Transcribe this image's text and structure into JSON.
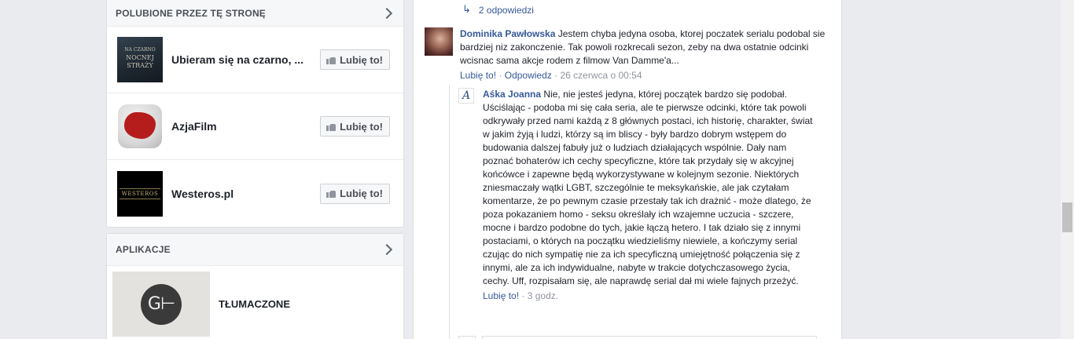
{
  "liked_pages": {
    "header": "POLUBIONE PRZEZ TĘ STRONĘ",
    "items": [
      {
        "name": "Ubieram się na czarno, ...",
        "like_label": "Lubię to!",
        "thumb_lines": [
          "NA CZARNO",
          "NOCNEJ",
          "STRAŻY"
        ]
      },
      {
        "name": "AzjaFilm",
        "like_label": "Lubię to!"
      },
      {
        "name": "Westeros.pl",
        "like_label": "Lubię to!",
        "thumb_text": "WESTEROS"
      }
    ]
  },
  "apps": {
    "header": "APLIKACJE",
    "items": [
      {
        "name": "TŁUMACZONE",
        "icon_text": "G⊢"
      }
    ]
  },
  "comments": {
    "replies_link": "2 odpowiedzi",
    "items": [
      {
        "author": "Dominika Pawłowska",
        "text": "Jestem chyba jedyna osoba, ktorej poczatek serialu podobal sie bardziej niz zakonczenie. Tak powoli rozkrecali sezon, zeby na dwa ostatnie odcinki wcisnac sama akcje rodem z filmow Van Damme'a...",
        "like_label": "Lubię to!",
        "reply_label": "Odpowiedz",
        "time": "26 czerwca o 00:54"
      },
      {
        "author": "Aśka Joanna",
        "avatar_letter": "A",
        "text": "Nie, nie jesteś jedyna, której początek bardzo się podobał. Uściślając - podoba mi się cała seria, ale te pierwsze odcinki, które tak powoli odkrywały przed nami każdą z 8 głównych postaci, ich historię, charakter, świat w jakim żyją i ludzi, którzy są im bliscy - były bardzo dobrym wstępem do budowania dalszej fabuły już o ludziach działających wspólnie. Dały nam poznać bohaterów ich cechy specyficzne, które tak przydały się w akcyjnej końcówce i zapewne będą wykorzystywane w kolejnym sezonie. Niektórych zniesmaczały wątki LGBT, szczególnie te meksykańskie, ale jak czytałam komentarze, że po pewnym czasie przestały tak ich drażnić - może dlatego, że poza pokazaniem homo - seksu określały ich wzajemne uczucia - szczere, mocne i bardzo podobne do tych, jakie łączą hetero. I tak działo się z innymi postaciami, o których na początku wiedzieliśmy niewiele, a kończymy serial czując do nich sympatię nie za ich specyficzną umiejętność połączenia się z innymi, ale za ich indywidualne, nabyte w trakcie dotychczasowego życia, cechy. Uff, rozpisałam się, ale naprawdę serial dał mi wiele fajnych przeżyć.",
        "like_label": "Lubię to!",
        "time": "3 godz."
      }
    ]
  },
  "colors": {
    "link": "#365899",
    "meta": "#90949c",
    "background": "#e9ebee"
  }
}
